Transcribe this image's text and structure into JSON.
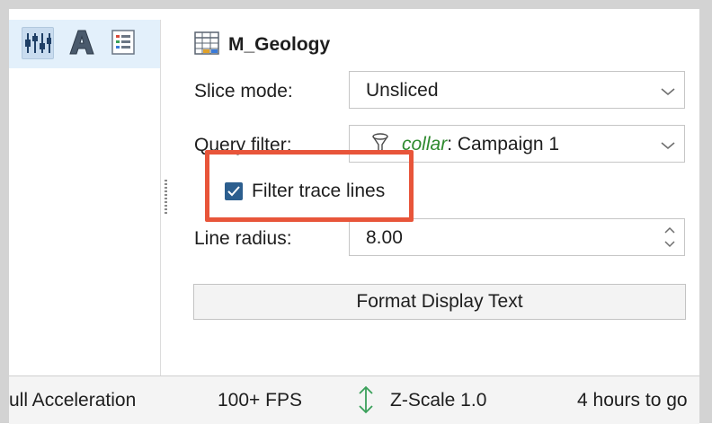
{
  "toolbar": {
    "icons": [
      "layer-adjust-icon",
      "text-style-icon",
      "legend-list-icon"
    ]
  },
  "panel": {
    "title": "M_Geology",
    "slice_mode": {
      "label": "Slice mode:",
      "value": "Unsliced"
    },
    "query_filter": {
      "label": "Query filter:",
      "table": "collar",
      "sep": ":",
      "value": " Campaign 1"
    },
    "filter_trace_lines": {
      "label": "Filter trace lines",
      "checked": true
    },
    "line_radius": {
      "label": "Line radius:",
      "value": "8.00"
    },
    "format_button": "Format Display Text"
  },
  "status": {
    "acceleration": "ull Acceleration",
    "fps": "100+ FPS",
    "zscale": "Z-Scale 1.0",
    "time_left": "4 hours to go"
  },
  "colors": {
    "highlight": "#e8553a",
    "checkbox": "#2c5e8e",
    "filter_table": "#2f8a2f",
    "toolbar_bg": "#e3f0fb"
  }
}
